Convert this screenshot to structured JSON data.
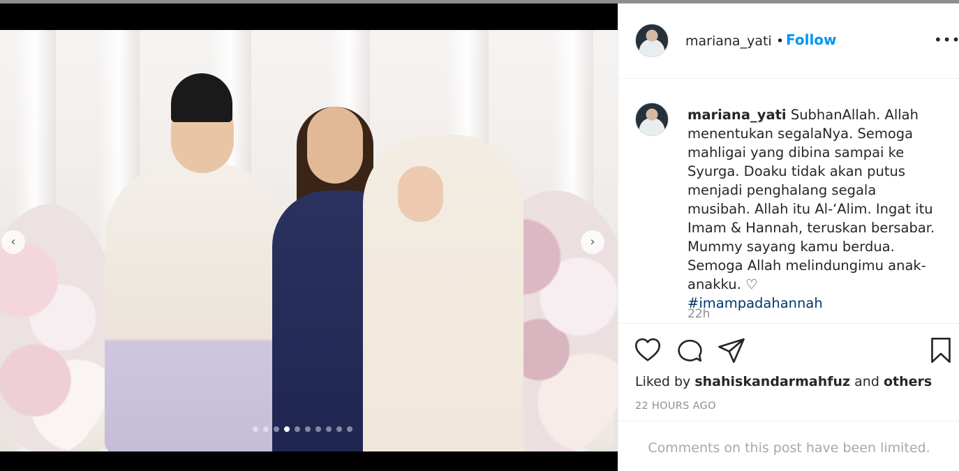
{
  "post": {
    "username": "mariana_yati",
    "bullet": "•",
    "follow_label": "Follow",
    "more_label": "•••",
    "caption_user": "mariana_yati",
    "caption_text": "SubhanAllah. Allah menentukan segalaNya. Semoga mahligai yang dibina sampai ke Syurga. Doaku tidak akan putus menjadi penghalang segala musibah. Allah itu Al-‘Alim. Ingat itu Imam & Hannah, teruskan bersabar. Mummy sayang kamu berdua. Semoga Allah melindungimu anak-anakku. ♡",
    "hashtag": "#imampadahannah",
    "time": "22h",
    "liked_by_prefix": "Liked by ",
    "liked_by_user": "shahiskandarmahfuz",
    "liked_by_and": " and ",
    "liked_by_others": "others",
    "post_age": "22 HOURS AGO",
    "comments_limited": "Comments on this post have been limited."
  },
  "carousel": {
    "prev_label": "‹",
    "next_label": "›",
    "slide_count": 10,
    "active_slide": 4
  },
  "colors": {
    "accent": "#0095f6",
    "hashtag": "#00376b",
    "muted": "#8e8e8e"
  },
  "icons": [
    "heart-icon",
    "comment-icon",
    "share-icon",
    "bookmark-icon",
    "more-icon"
  ]
}
